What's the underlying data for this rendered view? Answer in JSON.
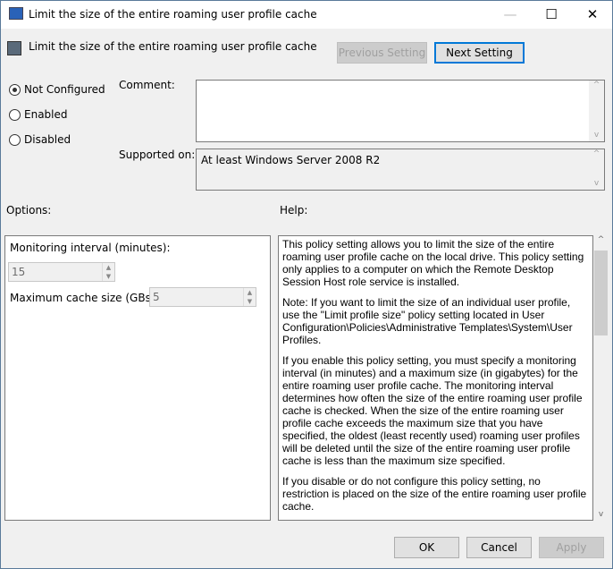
{
  "window": {
    "title": "Limit the size of the entire roaming user profile cache",
    "min": "—",
    "max": "☐",
    "close": "✕"
  },
  "header": {
    "title": "Limit the size of the entire roaming user profile cache",
    "prev": "Previous Setting",
    "next": "Next Setting"
  },
  "state": {
    "options": [
      "Not Configured",
      "Enabled",
      "Disabled"
    ],
    "selected": "Not Configured"
  },
  "comment_label": "Comment:",
  "comment_value": "",
  "supported_label": "Supported on:",
  "supported_value": "At least Windows Server 2008 R2",
  "options_label": "Options:",
  "help_label": "Help:",
  "options": {
    "interval_label": "Monitoring interval (minutes):",
    "interval_value": "15",
    "max_label": "Maximum cache size (GBs):",
    "max_value": "5"
  },
  "help": [
    "This policy setting allows you to limit the size of the entire roaming user profile cache on the local drive.  This policy setting only applies to a computer on which the Remote Desktop Session Host role service is installed.",
    "Note:  If you want to limit the size of an individual user profile, use the \"Limit profile size\" policy setting located in User Configuration\\Policies\\Administrative Templates\\System\\User Profiles.",
    "If you enable this policy setting, you must specify a monitoring interval (in minutes) and a maximum size (in gigabytes) for the entire roaming user profile cache. The monitoring interval determines how often the size of the entire roaming user profile cache is checked. When the size of the entire roaming user profile cache exceeds the maximum size that you have specified, the oldest (least recently used) roaming user profiles will be deleted until the size of the entire roaming user profile cache is less than the maximum size specified.",
    "If you disable or do not configure this policy setting, no restriction is placed on the size of the entire roaming user profile cache."
  ],
  "footer": {
    "ok": "OK",
    "cancel": "Cancel",
    "apply": "Apply"
  }
}
